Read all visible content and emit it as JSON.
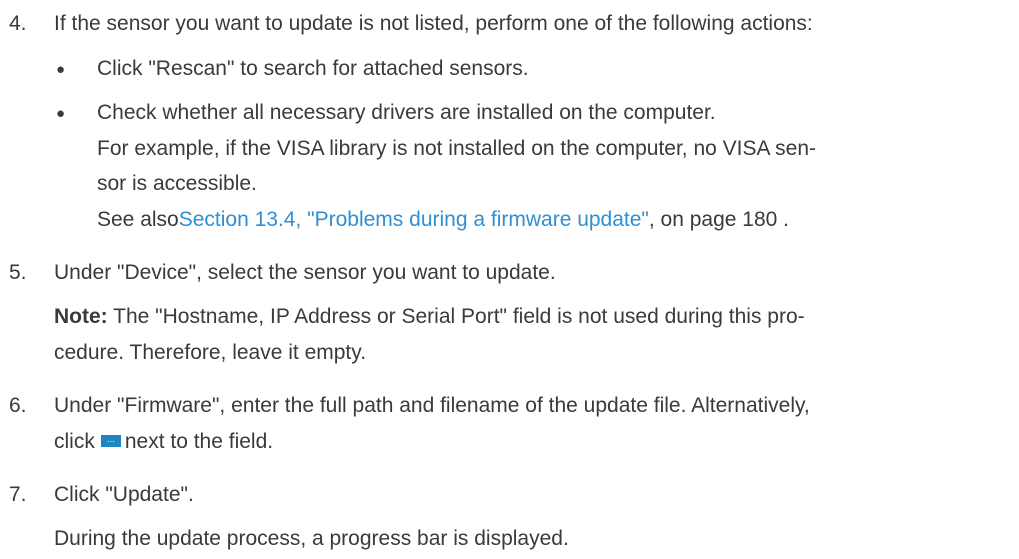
{
  "steps": [
    {
      "number": "4.",
      "text": "If the sensor you want to update is not listed, perform one of the following actions:",
      "bullets": [
        {
          "text": "Click \"Rescan\" to search for attached sensors."
        },
        {
          "text": "Check whether all necessary drivers are installed on the computer.",
          "cont1": "For example, if the VISA library is not installed on the computer, no VISA sen-",
          "cont2": "sor is accessible.",
          "see_prefix": "See also",
          "see_link": "Section 13.4, \"Problems during a firmware update\"",
          "see_suffix": ", on page 180 ."
        }
      ]
    },
    {
      "number": "5.",
      "text": "Under \"Device\", select the sensor you want to update.",
      "note_label": "Note:",
      "note_text": " The \"Hostname, IP Address or Serial Port\" field is not used during this pro-",
      "note_cont": "cedure. Therefore, leave it empty."
    },
    {
      "number": "6.",
      "text": "Under \"Firmware\", enter the full path and filename of the update file. Alternatively,",
      "cont_prefix": "click",
      "browse_button": "...",
      "cont_suffix": "next to the field."
    },
    {
      "number": "7.",
      "text": "Click \"Update\".",
      "result": "During the update process, a progress bar is displayed."
    }
  ],
  "bullet_char": "●"
}
